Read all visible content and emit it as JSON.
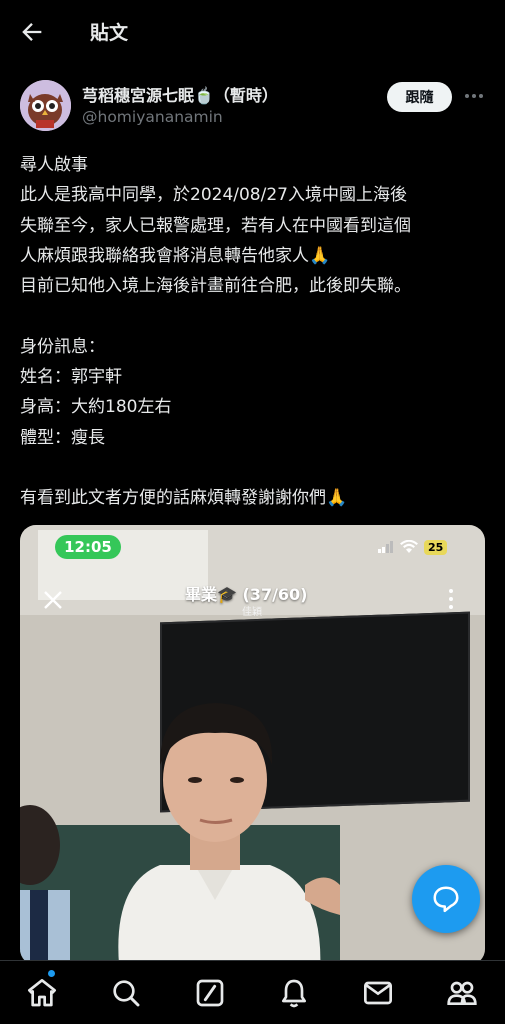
{
  "header": {
    "title": "貼文",
    "back_icon": "arrow-left-icon"
  },
  "author": {
    "display_name": "芎稻穗宮源七眠🍵（暫時）",
    "handle": "@homiyananamin",
    "follow_label": "跟隨",
    "more_icon": "more-horizontal-icon"
  },
  "post": {
    "lines": [
      "尋人啟事",
      "此人是我高中同學，於2024/08/27入境中國上海後",
      "失聯至今，家人已報警處理，若有人在中國看到這個",
      "人麻煩跟我聯絡我會將消息轉告他家人🙏",
      "目前已知他入境上海後計畫前往合肥，此後即失聯。",
      "",
      "身份訊息：",
      "姓名：郭宇軒",
      "身高：大約180左右",
      "體型：瘦長",
      "",
      "有看到此文者方便的話麻煩轉發謝謝你們🙏"
    ]
  },
  "media": {
    "status_time": "12:05",
    "battery": "25",
    "story_title": "畢業🎓  (37/60)",
    "story_subtitle": "佳穎"
  },
  "fab": {
    "icon": "reply-bubble-icon"
  },
  "tabbar": {
    "items": [
      {
        "icon": "home-icon",
        "active": true
      },
      {
        "icon": "search-icon",
        "active": false
      },
      {
        "icon": "grok-icon",
        "active": false
      },
      {
        "icon": "bell-icon",
        "active": false
      },
      {
        "icon": "mail-icon",
        "active": false
      },
      {
        "icon": "communities-icon",
        "active": false
      }
    ]
  },
  "colors": {
    "background": "#000000",
    "text": "#e7e9ea",
    "muted": "#71767b",
    "accent": "#1d9bf0"
  }
}
